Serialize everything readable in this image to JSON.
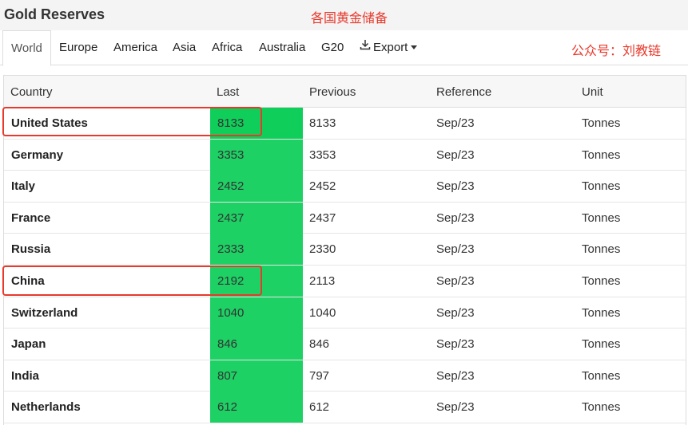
{
  "header": {
    "title": "Gold Reserves",
    "annotation_top": "各国黄金储备",
    "annotation_right": "公众号：刘教链"
  },
  "tabs": [
    {
      "label": "World",
      "active": true
    },
    {
      "label": "Europe"
    },
    {
      "label": "America"
    },
    {
      "label": "Asia"
    },
    {
      "label": "Africa"
    },
    {
      "label": "Australia"
    },
    {
      "label": "G20"
    },
    {
      "label": "Export",
      "icon": "download-icon"
    }
  ],
  "table": {
    "columns": [
      "Country",
      "Last",
      "Previous",
      "Reference",
      "Unit"
    ],
    "rows": [
      {
        "country": "United States",
        "last": "8133",
        "previous": "8133",
        "reference": "Sep/23",
        "unit": "Tonnes"
      },
      {
        "country": "Germany",
        "last": "3353",
        "previous": "3353",
        "reference": "Sep/23",
        "unit": "Tonnes"
      },
      {
        "country": "Italy",
        "last": "2452",
        "previous": "2452",
        "reference": "Sep/23",
        "unit": "Tonnes"
      },
      {
        "country": "France",
        "last": "2437",
        "previous": "2437",
        "reference": "Sep/23",
        "unit": "Tonnes"
      },
      {
        "country": "Russia",
        "last": "2333",
        "previous": "2330",
        "reference": "Sep/23",
        "unit": "Tonnes"
      },
      {
        "country": "China",
        "last": "2192",
        "previous": "2113",
        "reference": "Sep/23",
        "unit": "Tonnes"
      },
      {
        "country": "Switzerland",
        "last": "1040",
        "previous": "1040",
        "reference": "Sep/23",
        "unit": "Tonnes"
      },
      {
        "country": "Japan",
        "last": "846",
        "previous": "846",
        "reference": "Sep/23",
        "unit": "Tonnes"
      },
      {
        "country": "India",
        "last": "807",
        "previous": "797",
        "reference": "Sep/23",
        "unit": "Tonnes"
      },
      {
        "country": "Netherlands",
        "last": "612",
        "previous": "612",
        "reference": "Sep/23",
        "unit": "Tonnes"
      }
    ]
  },
  "colors": {
    "accent_red": "#e8392c",
    "last_cell_green": "#1dd164"
  }
}
